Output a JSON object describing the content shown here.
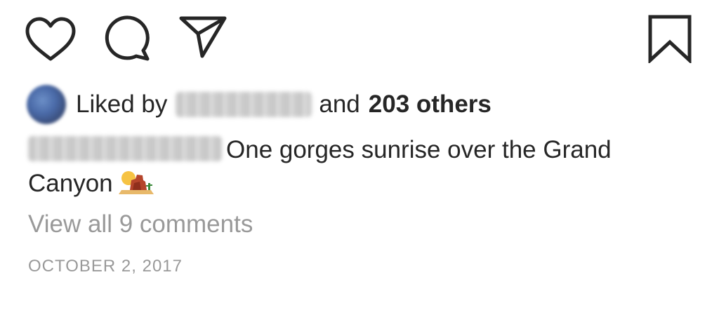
{
  "actions": {
    "like_icon": "heart-icon",
    "comment_icon": "comment-bubble-icon",
    "share_icon": "paper-plane-icon",
    "save_icon": "bookmark-icon"
  },
  "likes": {
    "prefix": "Liked by",
    "middle": "and",
    "others": "203 others"
  },
  "caption": {
    "text_line1": "One gorges sunrise over the Grand",
    "text_line2": "Canyon",
    "emoji": "desert-sunrise-emoji"
  },
  "comments": {
    "view_all": "View all 9 comments"
  },
  "post": {
    "date": "OCTOBER 2, 2017"
  },
  "colors": {
    "text": "#262626",
    "muted": "#999999",
    "background": "#ffffff"
  }
}
